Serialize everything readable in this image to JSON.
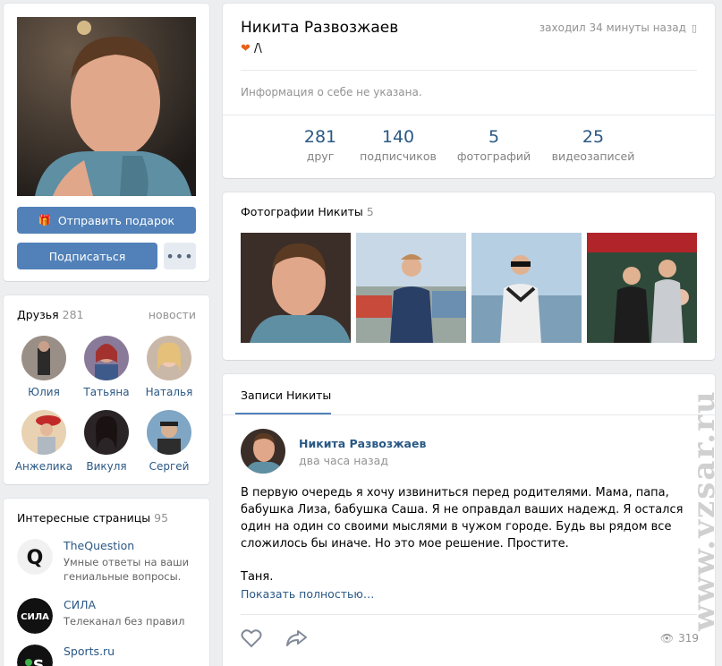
{
  "profile": {
    "name": "Никита Развозжаев",
    "status_text": "/\\",
    "last_seen": "заходил 34 минуты назад",
    "about": "Информация о себе не указана.",
    "counters": [
      {
        "num": "281",
        "label": "друг"
      },
      {
        "num": "140",
        "label": "подписчиков"
      },
      {
        "num": "5",
        "label": "фотографий"
      },
      {
        "num": "25",
        "label": "видеозаписей"
      }
    ]
  },
  "actions": {
    "gift_label": "Отправить подарок",
    "subscribe_label": "Подписаться",
    "more_label": "•••"
  },
  "friends": {
    "title": "Друзья",
    "count": "281",
    "link": "новости",
    "items": [
      {
        "name": "Юлия"
      },
      {
        "name": "Татьяна"
      },
      {
        "name": "Наталья"
      },
      {
        "name": "Анжелика"
      },
      {
        "name": "Викуля"
      },
      {
        "name": "Сергей"
      }
    ]
  },
  "pages": {
    "title": "Интересные страницы",
    "count": "95",
    "items": [
      {
        "title": "TheQuestion",
        "desc": "Умные ответы на ваши гениальные вопросы.",
        "logo": "Q"
      },
      {
        "title": "СИЛА",
        "desc": "Телеканал без правил",
        "logo": "СИЛА"
      },
      {
        "title": "Sports.ru",
        "desc": "",
        "logo": "s"
      }
    ]
  },
  "photos": {
    "title": "Фотографии Никиты",
    "count": "5"
  },
  "wall": {
    "tab": "Записи Никиты",
    "post": {
      "author": "Никита Развозжаев",
      "time": "два часа назад",
      "text": "В первую очередь я хочу извиниться перед родителями. Мама, папа, бабушка Лиза, бабушка Саша. Я не оправдал ваших надежд. Я остался один на один со своими мыслями в чужом городе. Будь вы рядом все сложилось бы иначе. Но это мое решение. Простите.",
      "signature": "Таня.",
      "show_more": "Показать полностью…",
      "views": "319"
    }
  },
  "watermark": "www.vzsar.ru",
  "colors": {
    "accent": "#5181b8",
    "link": "#2a5885",
    "background": "#edeef0"
  }
}
